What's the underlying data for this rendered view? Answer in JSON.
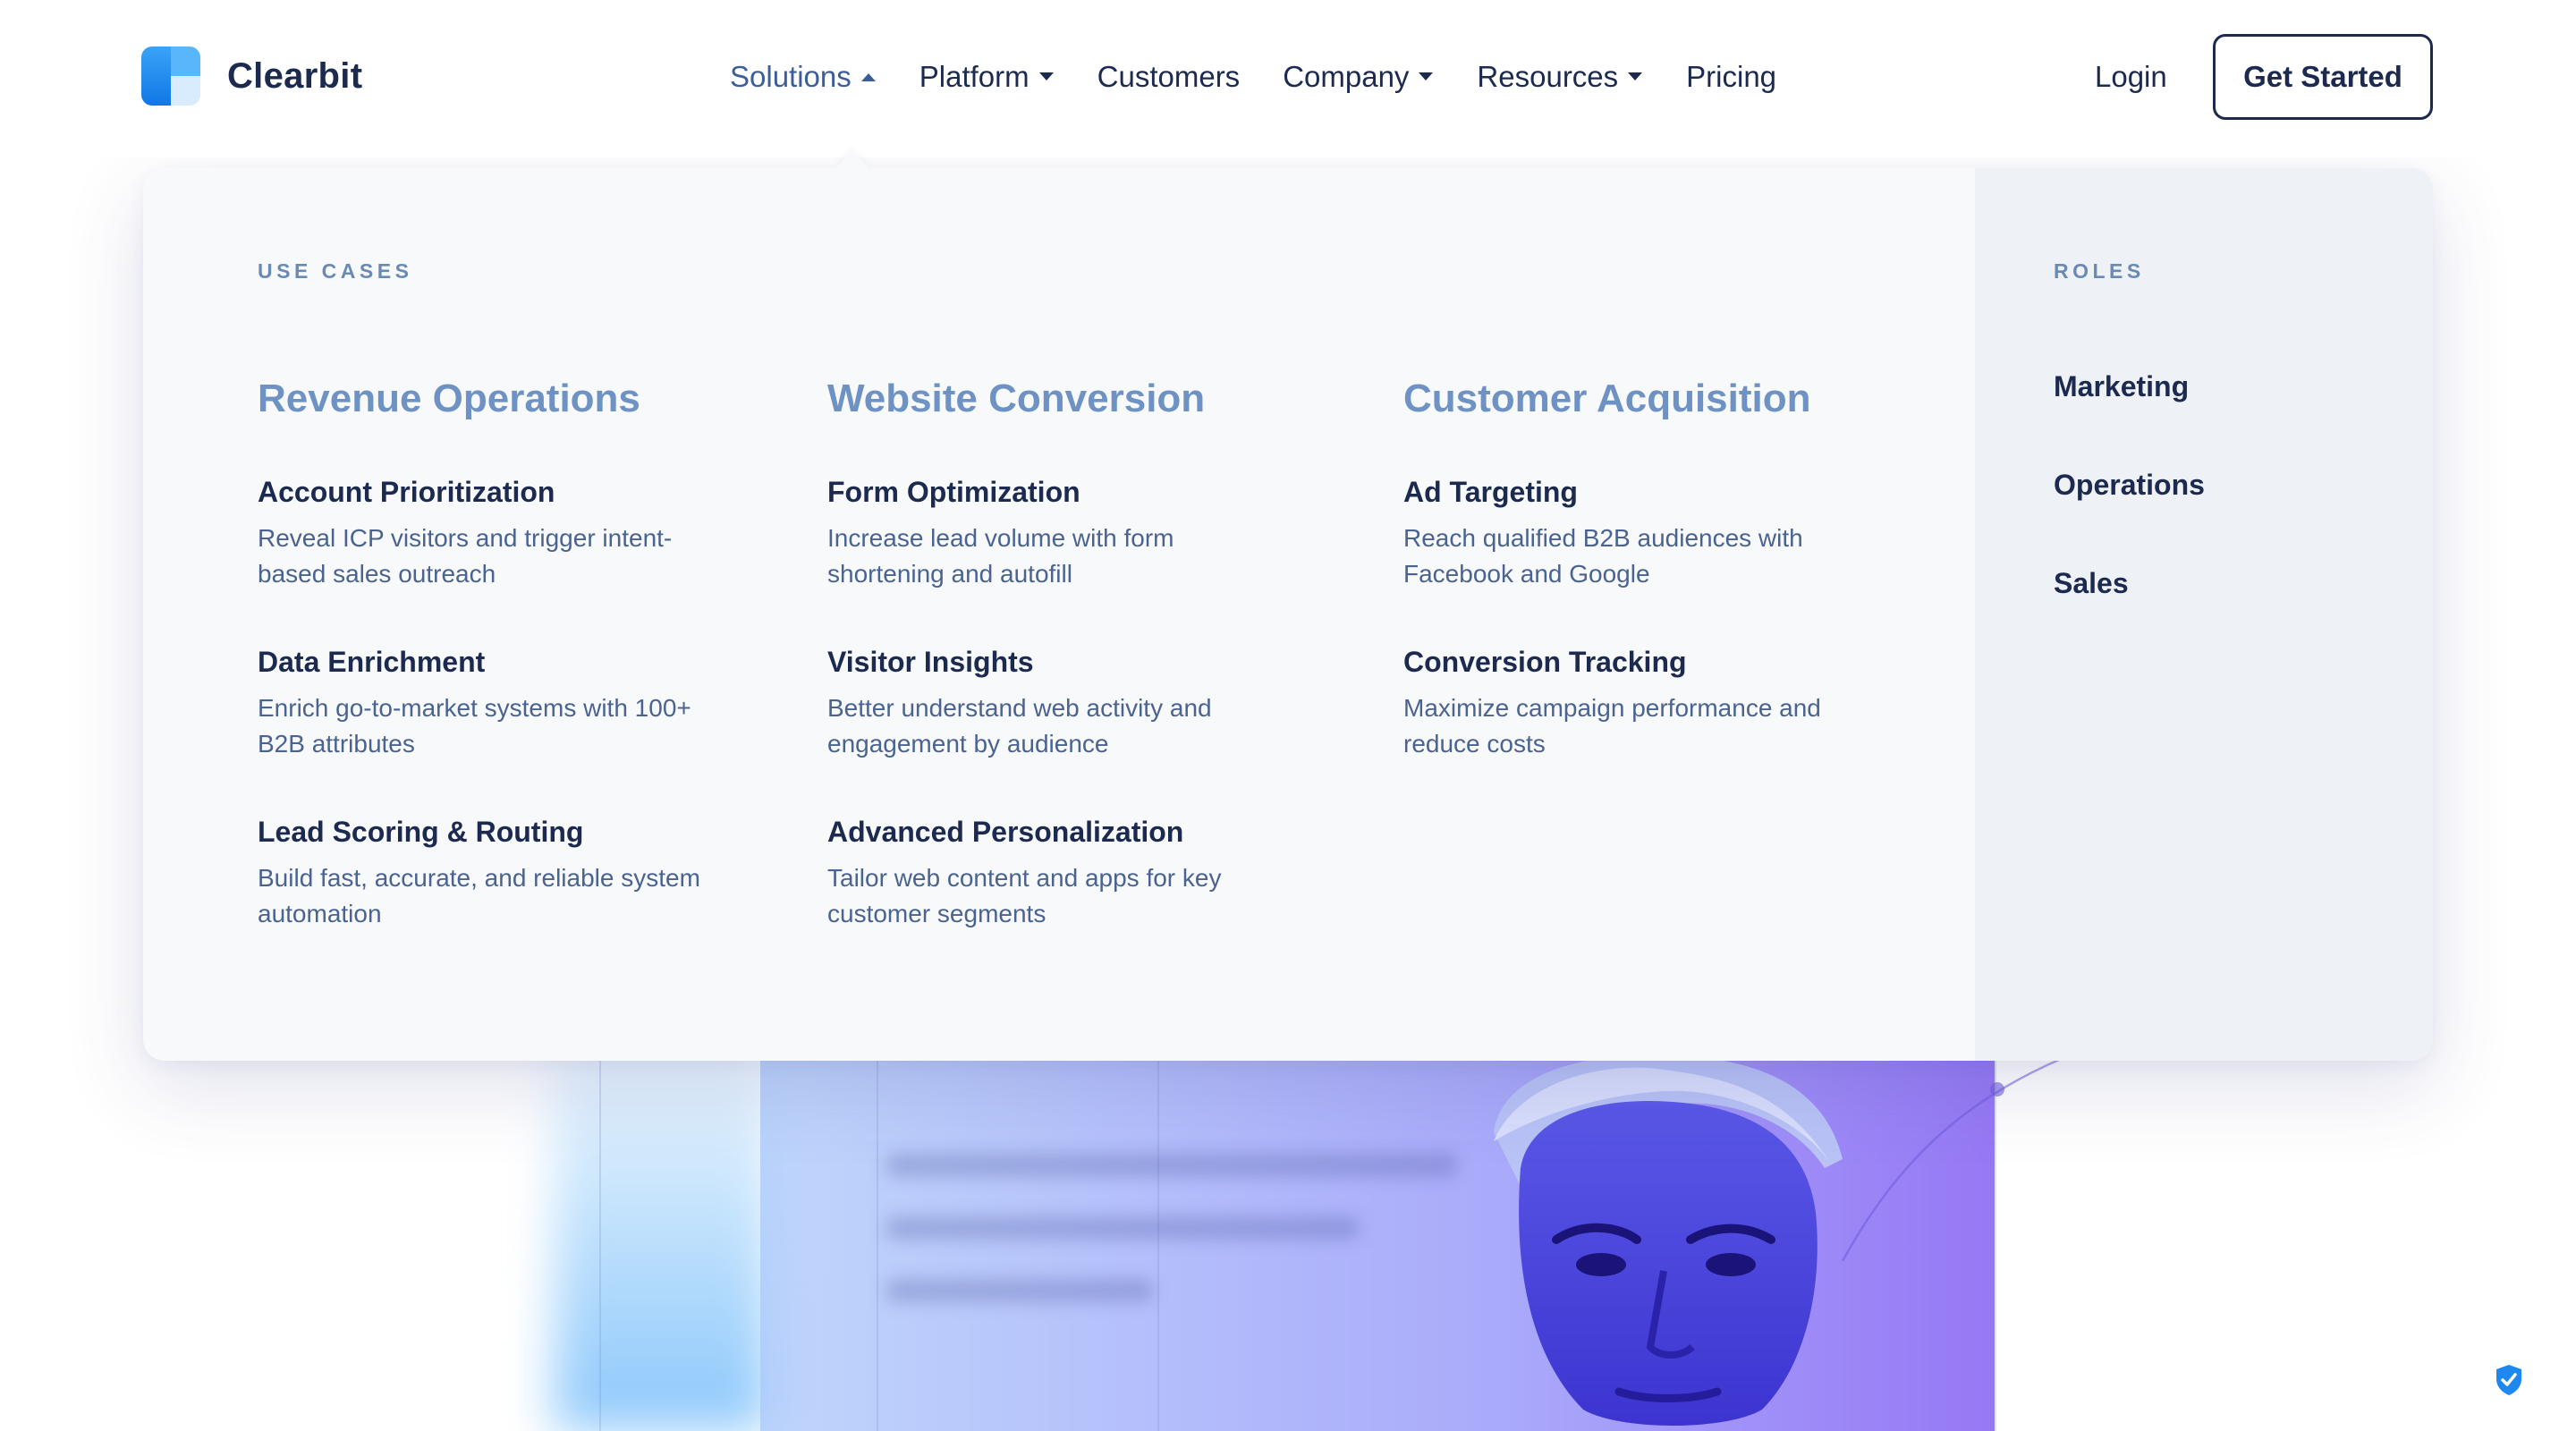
{
  "brand": {
    "name": "Clearbit"
  },
  "nav": {
    "items": [
      {
        "label": "Solutions",
        "has_caret": true,
        "active": true
      },
      {
        "label": "Platform",
        "has_caret": true
      },
      {
        "label": "Customers",
        "has_caret": false
      },
      {
        "label": "Company",
        "has_caret": true
      },
      {
        "label": "Resources",
        "has_caret": true
      },
      {
        "label": "Pricing",
        "has_caret": false
      }
    ],
    "login_label": "Login",
    "cta_label": "Get Started"
  },
  "mega_menu": {
    "use_cases_heading": "USE CASES",
    "columns": [
      {
        "title": "Revenue Operations",
        "features": [
          {
            "title": "Account Prioritization",
            "desc": "Reveal ICP visitors and trigger intent-based sales outreach"
          },
          {
            "title": "Data Enrichment",
            "desc": "Enrich go-to-market systems with 100+ B2B attributes"
          },
          {
            "title": "Lead Scoring & Routing",
            "desc": "Build fast, accurate, and reliable system automation"
          }
        ]
      },
      {
        "title": "Website Conversion",
        "features": [
          {
            "title": "Form Optimization",
            "desc": "Increase lead volume with form shortening and autofill"
          },
          {
            "title": "Visitor Insights",
            "desc": "Better understand web activity and engagement by audience"
          },
          {
            "title": "Advanced Personalization",
            "desc": "Tailor web content and apps for key customer segments"
          }
        ]
      },
      {
        "title": "Customer Acquisition",
        "features": [
          {
            "title": "Ad Targeting",
            "desc": "Reach qualified B2B audiences with Facebook and Google"
          },
          {
            "title": "Conversion Tracking",
            "desc": "Maximize campaign performance and reduce costs"
          }
        ]
      }
    ],
    "roles_heading": "ROLES",
    "roles": [
      "Marketing",
      "Operations",
      "Sales"
    ]
  },
  "icons": {
    "logo": "clearbit-logo-icon",
    "caret_down": "caret-down-icon",
    "caret_up": "caret-up-icon",
    "shield": "shield-check-icon"
  },
  "colors": {
    "ink": "#1b2a4e",
    "accent_title": "#6e92c4",
    "muted_text": "#4a6390",
    "brand_blue": "#1e88f0",
    "hero_purple": "#8a7cf5"
  }
}
